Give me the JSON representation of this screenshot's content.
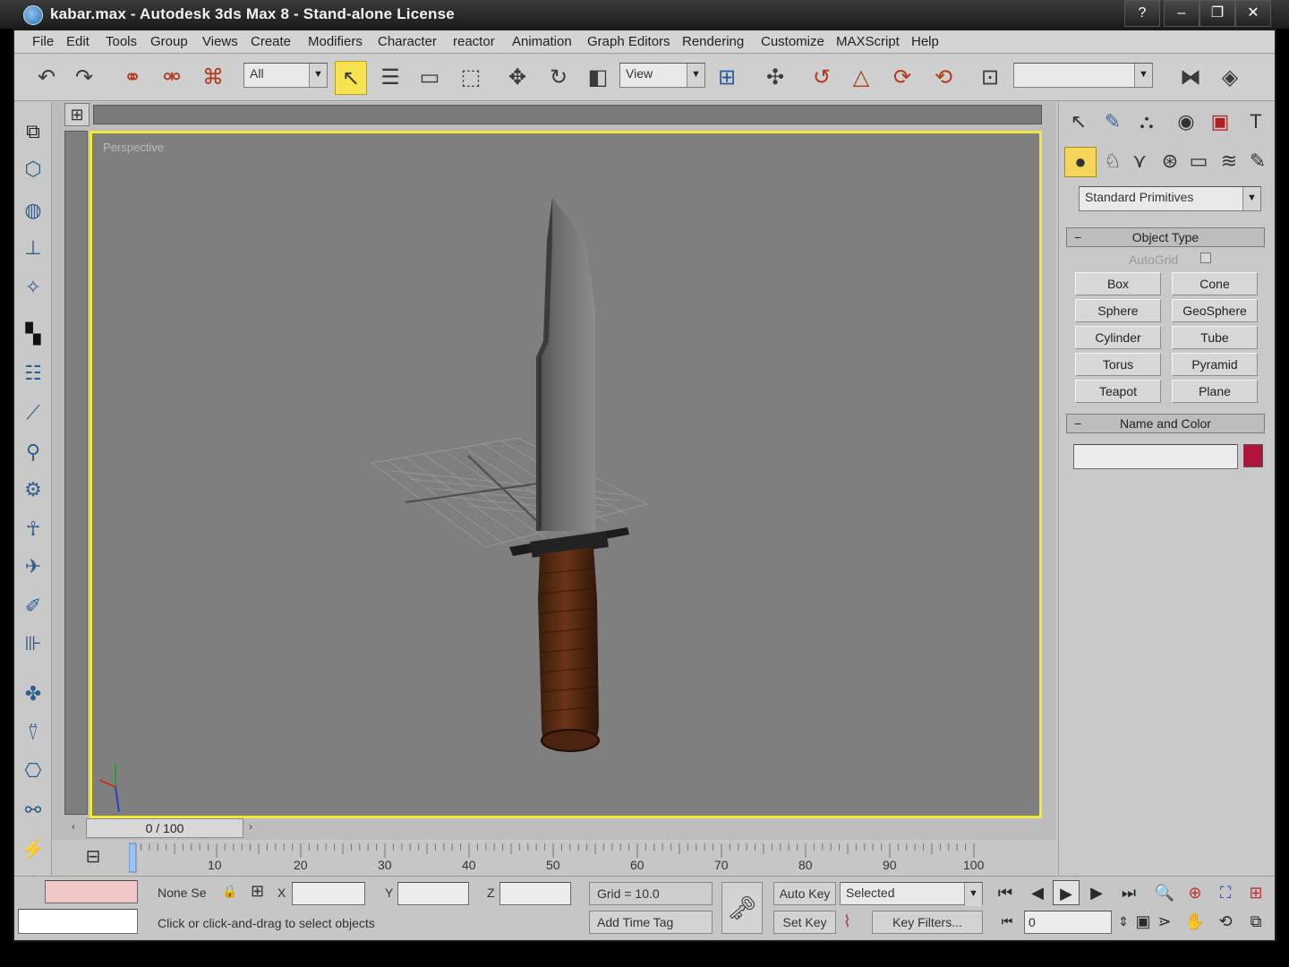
{
  "window": {
    "title": "kabar.max - Autodesk 3ds Max 8 - Stand-alone License",
    "buttons": [
      "?",
      "–",
      "❐",
      "✕"
    ]
  },
  "menu": [
    "File",
    "Edit",
    "Tools",
    "Group",
    "Views",
    "Create",
    "Modifiers",
    "Character",
    "reactor",
    "Animation",
    "Graph Editors",
    "Rendering",
    "Customize",
    "MAXScript",
    "Help"
  ],
  "toolbar": {
    "selection_filter": "All",
    "reference_coord": "View",
    "named_selection": ""
  },
  "viewport": {
    "label": "Perspective",
    "active_border_color": "#f1ea3a",
    "background_color": "#7f7f7f"
  },
  "timeline": {
    "frame_display": "0 / 100",
    "ticks": [
      "10",
      "20",
      "30",
      "40",
      "50",
      "60",
      "70",
      "80",
      "90",
      "100"
    ]
  },
  "status": {
    "selection_text": "None Se",
    "x_label": "X",
    "y_label": "Y",
    "z_label": "Z",
    "x_value": "",
    "y_value": "",
    "z_value": "",
    "grid": "Grid = 10.0",
    "add_time_tag": "Add Time Tag",
    "prompt": "Click or click-and-drag to select objects",
    "auto_key": "Auto Key",
    "set_key": "Set Key",
    "key_mode": "Selected",
    "key_filters": "Key Filters...",
    "current_frame": "0"
  },
  "command_panel": {
    "category": "Standard Primitives",
    "object_type_title": "Object Type",
    "autogrid": "AutoGrid",
    "primitives": [
      "Box",
      "Cone",
      "Sphere",
      "GeoSphere",
      "Cylinder",
      "Tube",
      "Torus",
      "Pyramid",
      "Teapot",
      "Plane"
    ],
    "name_color_title": "Name and Color",
    "object_name": "",
    "object_color": "#b3123a"
  }
}
